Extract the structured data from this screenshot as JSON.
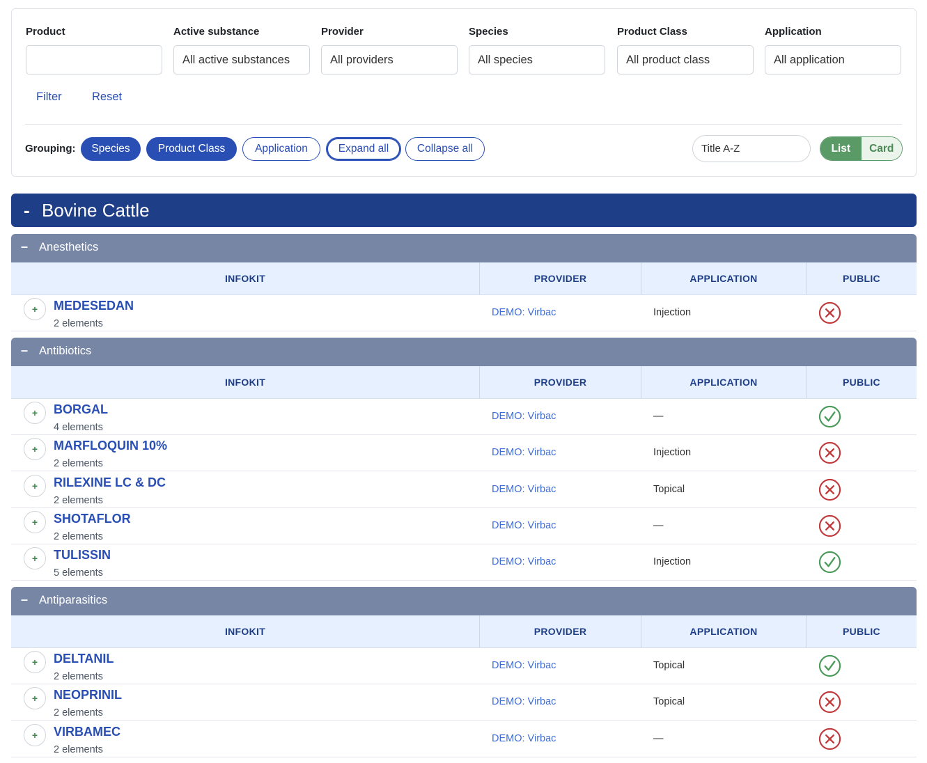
{
  "filters": {
    "product": {
      "label": "Product",
      "value": ""
    },
    "active_substance": {
      "label": "Active substance",
      "value": "All active substances"
    },
    "provider": {
      "label": "Provider",
      "value": "All providers"
    },
    "species": {
      "label": "Species",
      "value": "All species"
    },
    "product_class": {
      "label": "Product Class",
      "value": "All product class"
    },
    "application": {
      "label": "Application",
      "value": "All application"
    },
    "filter_label": "Filter",
    "reset_label": "Reset"
  },
  "grouping": {
    "label": "Grouping:",
    "species": "Species",
    "product_class": "Product Class",
    "application": "Application",
    "expand_all": "Expand all",
    "collapse_all": "Collapse all"
  },
  "sort": {
    "value": "Title A-Z"
  },
  "view_toggle": {
    "list": "List",
    "card": "Card",
    "active": "List"
  },
  "columns": {
    "infokit": "INFOKIT",
    "provider": "PROVIDER",
    "application": "APPLICATION",
    "public": "PUBLIC"
  },
  "species_group": {
    "toggle": "-",
    "title": "Bovine Cattle"
  },
  "classes": [
    {
      "toggle": "–",
      "title": "Anesthetics",
      "rows": [
        {
          "plus": "+",
          "name": "MEDESEDAN",
          "count": "2 elements",
          "provider": "DEMO: Virbac",
          "application": "Injection",
          "public": false
        }
      ]
    },
    {
      "toggle": "–",
      "title": "Antibiotics",
      "rows": [
        {
          "plus": "+",
          "name": "BORGAL",
          "count": "4 elements",
          "provider": "DEMO: Virbac",
          "application": "—",
          "public": true
        },
        {
          "plus": "+",
          "name": "MARFLOQUIN 10%",
          "count": "2 elements",
          "provider": "DEMO: Virbac",
          "application": "Injection",
          "public": false
        },
        {
          "plus": "+",
          "name": "RILEXINE LC & DC",
          "count": "2 elements",
          "provider": "DEMO: Virbac",
          "application": "Topical",
          "public": false
        },
        {
          "plus": "+",
          "name": "SHOTAFLOR",
          "count": "2 elements",
          "provider": "DEMO: Virbac",
          "application": "—",
          "public": false
        },
        {
          "plus": "+",
          "name": "TULISSIN",
          "count": "5 elements",
          "provider": "DEMO: Virbac",
          "application": "Injection",
          "public": true
        }
      ]
    },
    {
      "toggle": "–",
      "title": "Antiparasitics",
      "rows": [
        {
          "plus": "+",
          "name": "DELTANIL",
          "count": "2 elements",
          "provider": "DEMO: Virbac",
          "application": "Topical",
          "public": true
        },
        {
          "plus": "+",
          "name": "NEOPRINIL",
          "count": "2 elements",
          "provider": "DEMO: Virbac",
          "application": "Topical",
          "public": false
        },
        {
          "plus": "+",
          "name": "VIRBAMEC",
          "count": "2 elements",
          "provider": "DEMO: Virbac",
          "application": "—",
          "public": false
        }
      ]
    }
  ],
  "colors": {
    "primary": "#2a4fb4",
    "species_bar": "#1e3e88",
    "class_bar": "#7786a5",
    "header_bg": "#e7f0fe",
    "public_yes": "#4a9a5a",
    "public_no": "#c0393b"
  },
  "icons": {
    "public_yes": "check-circle-icon",
    "public_no": "x-circle-icon"
  }
}
